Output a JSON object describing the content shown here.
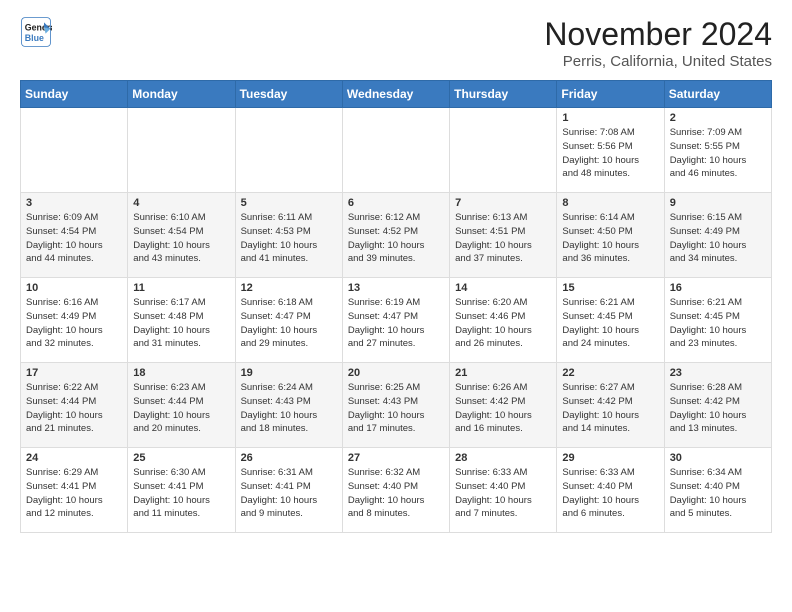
{
  "header": {
    "logo_line1": "General",
    "logo_line2": "Blue",
    "title": "November 2024",
    "subtitle": "Perris, California, United States"
  },
  "weekdays": [
    "Sunday",
    "Monday",
    "Tuesday",
    "Wednesday",
    "Thursday",
    "Friday",
    "Saturday"
  ],
  "weeks": [
    [
      {
        "day": "",
        "info": ""
      },
      {
        "day": "",
        "info": ""
      },
      {
        "day": "",
        "info": ""
      },
      {
        "day": "",
        "info": ""
      },
      {
        "day": "",
        "info": ""
      },
      {
        "day": "1",
        "info": "Sunrise: 7:08 AM\nSunset: 5:56 PM\nDaylight: 10 hours\nand 48 minutes."
      },
      {
        "day": "2",
        "info": "Sunrise: 7:09 AM\nSunset: 5:55 PM\nDaylight: 10 hours\nand 46 minutes."
      }
    ],
    [
      {
        "day": "3",
        "info": "Sunrise: 6:09 AM\nSunset: 4:54 PM\nDaylight: 10 hours\nand 44 minutes."
      },
      {
        "day": "4",
        "info": "Sunrise: 6:10 AM\nSunset: 4:54 PM\nDaylight: 10 hours\nand 43 minutes."
      },
      {
        "day": "5",
        "info": "Sunrise: 6:11 AM\nSunset: 4:53 PM\nDaylight: 10 hours\nand 41 minutes."
      },
      {
        "day": "6",
        "info": "Sunrise: 6:12 AM\nSunset: 4:52 PM\nDaylight: 10 hours\nand 39 minutes."
      },
      {
        "day": "7",
        "info": "Sunrise: 6:13 AM\nSunset: 4:51 PM\nDaylight: 10 hours\nand 37 minutes."
      },
      {
        "day": "8",
        "info": "Sunrise: 6:14 AM\nSunset: 4:50 PM\nDaylight: 10 hours\nand 36 minutes."
      },
      {
        "day": "9",
        "info": "Sunrise: 6:15 AM\nSunset: 4:49 PM\nDaylight: 10 hours\nand 34 minutes."
      }
    ],
    [
      {
        "day": "10",
        "info": "Sunrise: 6:16 AM\nSunset: 4:49 PM\nDaylight: 10 hours\nand 32 minutes."
      },
      {
        "day": "11",
        "info": "Sunrise: 6:17 AM\nSunset: 4:48 PM\nDaylight: 10 hours\nand 31 minutes."
      },
      {
        "day": "12",
        "info": "Sunrise: 6:18 AM\nSunset: 4:47 PM\nDaylight: 10 hours\nand 29 minutes."
      },
      {
        "day": "13",
        "info": "Sunrise: 6:19 AM\nSunset: 4:47 PM\nDaylight: 10 hours\nand 27 minutes."
      },
      {
        "day": "14",
        "info": "Sunrise: 6:20 AM\nSunset: 4:46 PM\nDaylight: 10 hours\nand 26 minutes."
      },
      {
        "day": "15",
        "info": "Sunrise: 6:21 AM\nSunset: 4:45 PM\nDaylight: 10 hours\nand 24 minutes."
      },
      {
        "day": "16",
        "info": "Sunrise: 6:21 AM\nSunset: 4:45 PM\nDaylight: 10 hours\nand 23 minutes."
      }
    ],
    [
      {
        "day": "17",
        "info": "Sunrise: 6:22 AM\nSunset: 4:44 PM\nDaylight: 10 hours\nand 21 minutes."
      },
      {
        "day": "18",
        "info": "Sunrise: 6:23 AM\nSunset: 4:44 PM\nDaylight: 10 hours\nand 20 minutes."
      },
      {
        "day": "19",
        "info": "Sunrise: 6:24 AM\nSunset: 4:43 PM\nDaylight: 10 hours\nand 18 minutes."
      },
      {
        "day": "20",
        "info": "Sunrise: 6:25 AM\nSunset: 4:43 PM\nDaylight: 10 hours\nand 17 minutes."
      },
      {
        "day": "21",
        "info": "Sunrise: 6:26 AM\nSunset: 4:42 PM\nDaylight: 10 hours\nand 16 minutes."
      },
      {
        "day": "22",
        "info": "Sunrise: 6:27 AM\nSunset: 4:42 PM\nDaylight: 10 hours\nand 14 minutes."
      },
      {
        "day": "23",
        "info": "Sunrise: 6:28 AM\nSunset: 4:42 PM\nDaylight: 10 hours\nand 13 minutes."
      }
    ],
    [
      {
        "day": "24",
        "info": "Sunrise: 6:29 AM\nSunset: 4:41 PM\nDaylight: 10 hours\nand 12 minutes."
      },
      {
        "day": "25",
        "info": "Sunrise: 6:30 AM\nSunset: 4:41 PM\nDaylight: 10 hours\nand 11 minutes."
      },
      {
        "day": "26",
        "info": "Sunrise: 6:31 AM\nSunset: 4:41 PM\nDaylight: 10 hours\nand 9 minutes."
      },
      {
        "day": "27",
        "info": "Sunrise: 6:32 AM\nSunset: 4:40 PM\nDaylight: 10 hours\nand 8 minutes."
      },
      {
        "day": "28",
        "info": "Sunrise: 6:33 AM\nSunset: 4:40 PM\nDaylight: 10 hours\nand 7 minutes."
      },
      {
        "day": "29",
        "info": "Sunrise: 6:33 AM\nSunset: 4:40 PM\nDaylight: 10 hours\nand 6 minutes."
      },
      {
        "day": "30",
        "info": "Sunrise: 6:34 AM\nSunset: 4:40 PM\nDaylight: 10 hours\nand 5 minutes."
      }
    ]
  ]
}
